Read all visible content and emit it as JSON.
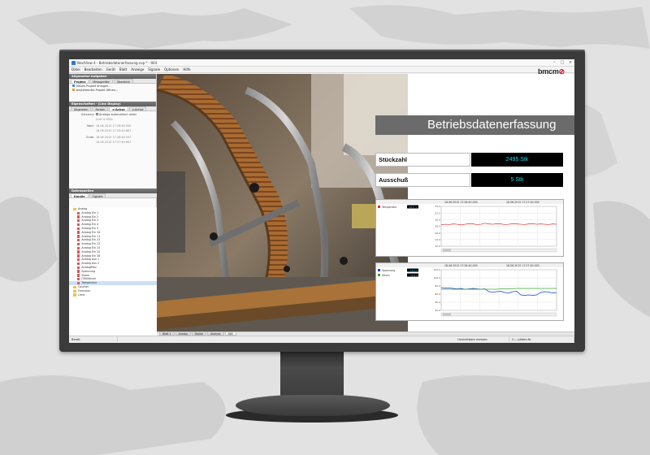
{
  "window": {
    "title": "NextView 4 - Betriebsdatenerfassung.nvp * - 904",
    "menu": [
      "Datei",
      "Bearbeiten",
      "Gerät",
      "Blatt",
      "Anzeige",
      "Signale",
      "Optionen",
      "Hilfe"
    ]
  },
  "left_panel": {
    "header": "Allgemeine Aufgaben",
    "tabs": [
      "Projekt",
      "Messgeräte",
      "Überblick"
    ],
    "items": [
      "Neues Projekt anlegen...",
      "bestehendes Projekt öffnen..."
    ],
    "props_header": "Eigenschaften - (Line Display)",
    "props_tabs": [
      "Allgemein",
      "Farben",
      "x-Achse",
      "y-Achse"
    ],
    "fields": {
      "gateway_label": "Gatewary",
      "gateway_value": "Anzeige automatisch rollen",
      "unit_label": "",
      "unit_value": "Unit: 0.300s",
      "start_label": "Start:",
      "start_value1": "18.06.2015 17:26:46.500",
      "start_value2": "18.06.2015 17:25:40.667",
      "ende_label": "Ende:",
      "ende_value1": "18.06.2015 17:26:48.597",
      "ende_value2": "18.06.2015 17:27:40.667"
    },
    "tree_header": "Datenquellen",
    "tree_tabs": [
      "Kanäle",
      "Signale"
    ],
    "tree": [
      {
        "label": "Analog",
        "type": "folder",
        "indent": 1
      },
      {
        "label": "Analog Ein 1",
        "type": "signal",
        "indent": 2
      },
      {
        "label": "Analog Ein 2",
        "type": "signal",
        "indent": 2
      },
      {
        "label": "Analog Ein 3",
        "type": "signal",
        "indent": 2
      },
      {
        "label": "Analog Ein 4",
        "type": "signal",
        "indent": 2
      },
      {
        "label": "Analog Ein 5",
        "type": "signal",
        "indent": 2
      },
      {
        "label": "Analog Ein 10",
        "type": "signal",
        "indent": 2
      },
      {
        "label": "Analog Ein 11",
        "type": "signal",
        "indent": 2
      },
      {
        "label": "Analog Ein 12",
        "type": "signal",
        "indent": 2
      },
      {
        "label": "Analog Ein 13",
        "type": "signal",
        "indent": 2
      },
      {
        "label": "Analog Ein 14",
        "type": "signal",
        "indent": 2
      },
      {
        "label": "Analog Ein 15",
        "type": "signal",
        "indent": 2
      },
      {
        "label": "Analog Ein 16",
        "type": "signal",
        "indent": 2
      },
      {
        "label": "Analog Aus 1",
        "type": "signal",
        "indent": 2
      },
      {
        "label": "Analog Aus 2",
        "type": "signal",
        "indent": 2
      },
      {
        "label": "AnalogPool",
        "type": "signal",
        "indent": 2
      },
      {
        "label": "Spannung",
        "type": "signal",
        "indent": 2
      },
      {
        "label": "Strom",
        "type": "signal",
        "indent": 2
      },
      {
        "label": "Ölfülldruck",
        "type": "signal",
        "indent": 2
      },
      {
        "label": "Temperatur",
        "type": "signal",
        "indent": 2,
        "selected": true
      },
      {
        "label": "Counter",
        "type": "folder",
        "indent": 1
      },
      {
        "label": "Formulas",
        "type": "folder",
        "indent": 1
      },
      {
        "label": "Limit",
        "type": "folder",
        "indent": 1
      }
    ]
  },
  "sheet_tabs": [
    "Blatt 1",
    "Analog",
    "Digital",
    "Analyse",
    "BDE"
  ],
  "statusbar": {
    "left": "Bereit",
    "middle": "Unsichtbare messen",
    "right": "C:...\\daten.fb"
  },
  "dashboard": {
    "logo_main": "bmcm",
    "logo_accent": "⊘",
    "title": "Betriebsdatenerfassung",
    "kpis": [
      {
        "label": "Stückzahl",
        "value": "2495 Stk"
      },
      {
        "label": "Ausschuß",
        "value": "5  Stk"
      }
    ]
  },
  "chart_data": [
    {
      "type": "line",
      "time_range": [
        "18.06.2015 17:26:40.000",
        "18.06.2015 17:27:00.000"
      ],
      "legend": [
        {
          "name": "Temperatur",
          "value": "28.8 °C",
          "color": "#d32f2f"
        }
      ],
      "yticks": [
        "34.0",
        "32.0",
        "30.0",
        "28.0",
        "26.0",
        "24.0",
        "22.0"
      ],
      "ylim": [
        22,
        34
      ],
      "series": [
        {
          "name": "Temperatur",
          "color": "#d32f2f",
          "values": [
            28.4,
            28.6,
            28.5,
            28.7,
            28.6,
            28.4,
            28.6,
            28.8,
            28.7,
            28.5,
            28.6,
            28.9,
            28.7,
            28.6,
            28.8,
            28.7,
            28.5,
            28.6,
            28.8,
            28.7,
            28.6,
            28.5,
            28.7,
            28.8,
            28.6,
            28.7,
            28.6,
            28.5,
            28.7,
            28.6
          ]
        }
      ]
    },
    {
      "type": "line",
      "time_range": [
        "18.06.2015 17:26:40.000",
        "18.06.2015 17:27:00.000"
      ],
      "legend": [
        {
          "name": "Spannung",
          "value": "56.0 V",
          "color": "#1a3fd1"
        },
        {
          "name": "Strom",
          "value": "74.8 A",
          "color": "#3aa832"
        }
      ],
      "yticks": [
        "120.0",
        "100.0",
        "80.0",
        "60.0",
        "40.0",
        "20.0"
      ],
      "ylim": [
        20,
        120
      ],
      "series": [
        {
          "name": "Spannung",
          "color": "#1a3fd1",
          "values": [
            76,
            75,
            75,
            74,
            73,
            74,
            72,
            73,
            74,
            73,
            72,
            73,
            66,
            65,
            66,
            67,
            64,
            63,
            66,
            67,
            58,
            57,
            58,
            57,
            58,
            64,
            66,
            65,
            63,
            64
          ]
        },
        {
          "name": "Strom",
          "color": "#3aa832",
          "values": [
            72,
            72,
            72,
            72,
            72,
            72,
            72,
            72,
            72,
            72,
            72,
            72,
            72,
            72,
            72,
            73,
            73,
            73,
            73,
            74,
            74,
            74,
            74,
            74,
            74,
            74,
            74,
            74,
            74,
            74
          ]
        }
      ]
    }
  ]
}
